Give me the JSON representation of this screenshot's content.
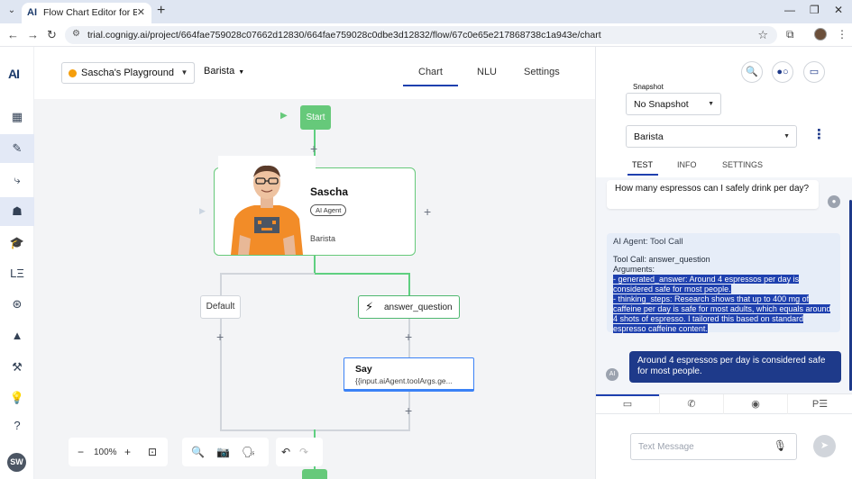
{
  "browser": {
    "tab_logo": "AI",
    "tab_title": "Flow Chart Editor for Barista | C",
    "url": "trial.cognigy.ai/project/664fae759028c07662d12830/664fae759028c0dbe3d12832/flow/67c0e65e217868738c1a943e/chart"
  },
  "rail": {
    "logo": "AI",
    "avatar": "SW"
  },
  "topbar": {
    "project_name": "Sascha's Playground",
    "flow_name": "Barista",
    "tabs": [
      "Chart",
      "NLU",
      "Settings"
    ]
  },
  "flow": {
    "start_label": "Start",
    "agent": {
      "name": "Sascha",
      "badge": "AI Agent",
      "subtitle": "Barista"
    },
    "default_label": "Default",
    "tool_label": "answer_question",
    "say": {
      "title": "Say",
      "body": "{{input.aiAgent.toolArgs.ge..."
    }
  },
  "zoom": {
    "level": "100%"
  },
  "panel": {
    "snapshot_label": "Snapshot",
    "snapshot_value": "No Snapshot",
    "flow_value": "Barista",
    "tabs": [
      "TEST",
      "INFO",
      "SETTINGS"
    ],
    "user_message": "How many espressos can I safely drink per day?",
    "tool_card": {
      "title": "AI Agent: Tool Call",
      "tool_call_label": "Tool Call:",
      "tool_call_value": "answer_question",
      "arguments_label": "Arguments:",
      "lines": [
        "- generated_answer: Around 4 espressos per day is",
        "considered safe for most people.",
        "- thinking_steps: Research shows that up to 400 mg of",
        "caffeine per day is safe for most adults, which equals around",
        "4 shots of espresso. I tailored this based on standard",
        "espresso caffeine content."
      ]
    },
    "bot_message": "Around 4 espressos per day is considered safe for most people.",
    "bot_avatar": "AI",
    "input_placeholder": "Text Message"
  }
}
